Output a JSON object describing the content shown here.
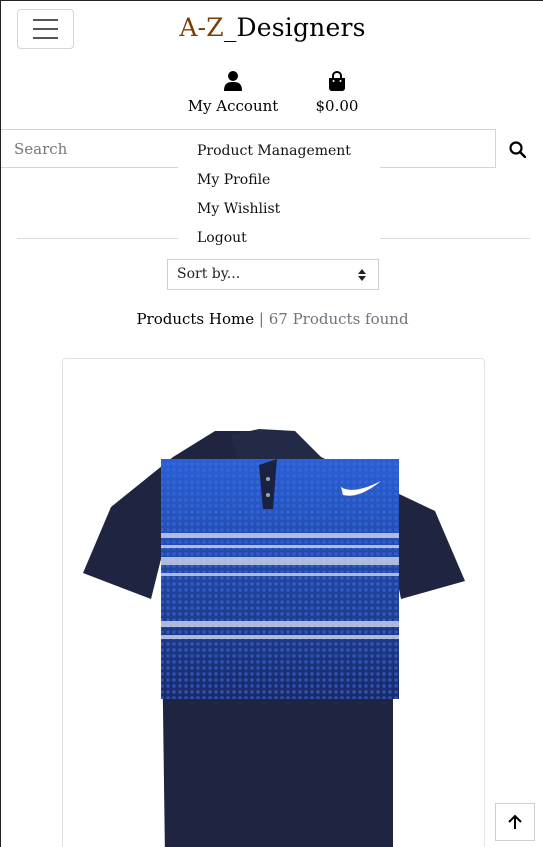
{
  "header": {
    "brand_accent": "A-Z",
    "brand_rest": "_Designers",
    "account_label": "My Account",
    "bag_total": "$0.00"
  },
  "search": {
    "placeholder": "Search"
  },
  "account_menu": {
    "items": [
      "Product Management",
      "My Profile",
      "My Wishlist",
      "Logout"
    ]
  },
  "sort": {
    "selected": "Sort by..."
  },
  "results": {
    "home_link": "Products Home",
    "separator": "|",
    "count_text": "67 Products found"
  },
  "product": {
    "image_icon": "polo-shirt-image"
  },
  "icons": {
    "menu": "hamburger-menu-icon",
    "account": "user-icon",
    "bag": "shopping-bag-icon",
    "search": "search-icon",
    "back_to_top": "arrow-up-icon"
  },
  "colors": {
    "brand_accent": "#7a3e08",
    "muted": "#6c757d"
  }
}
